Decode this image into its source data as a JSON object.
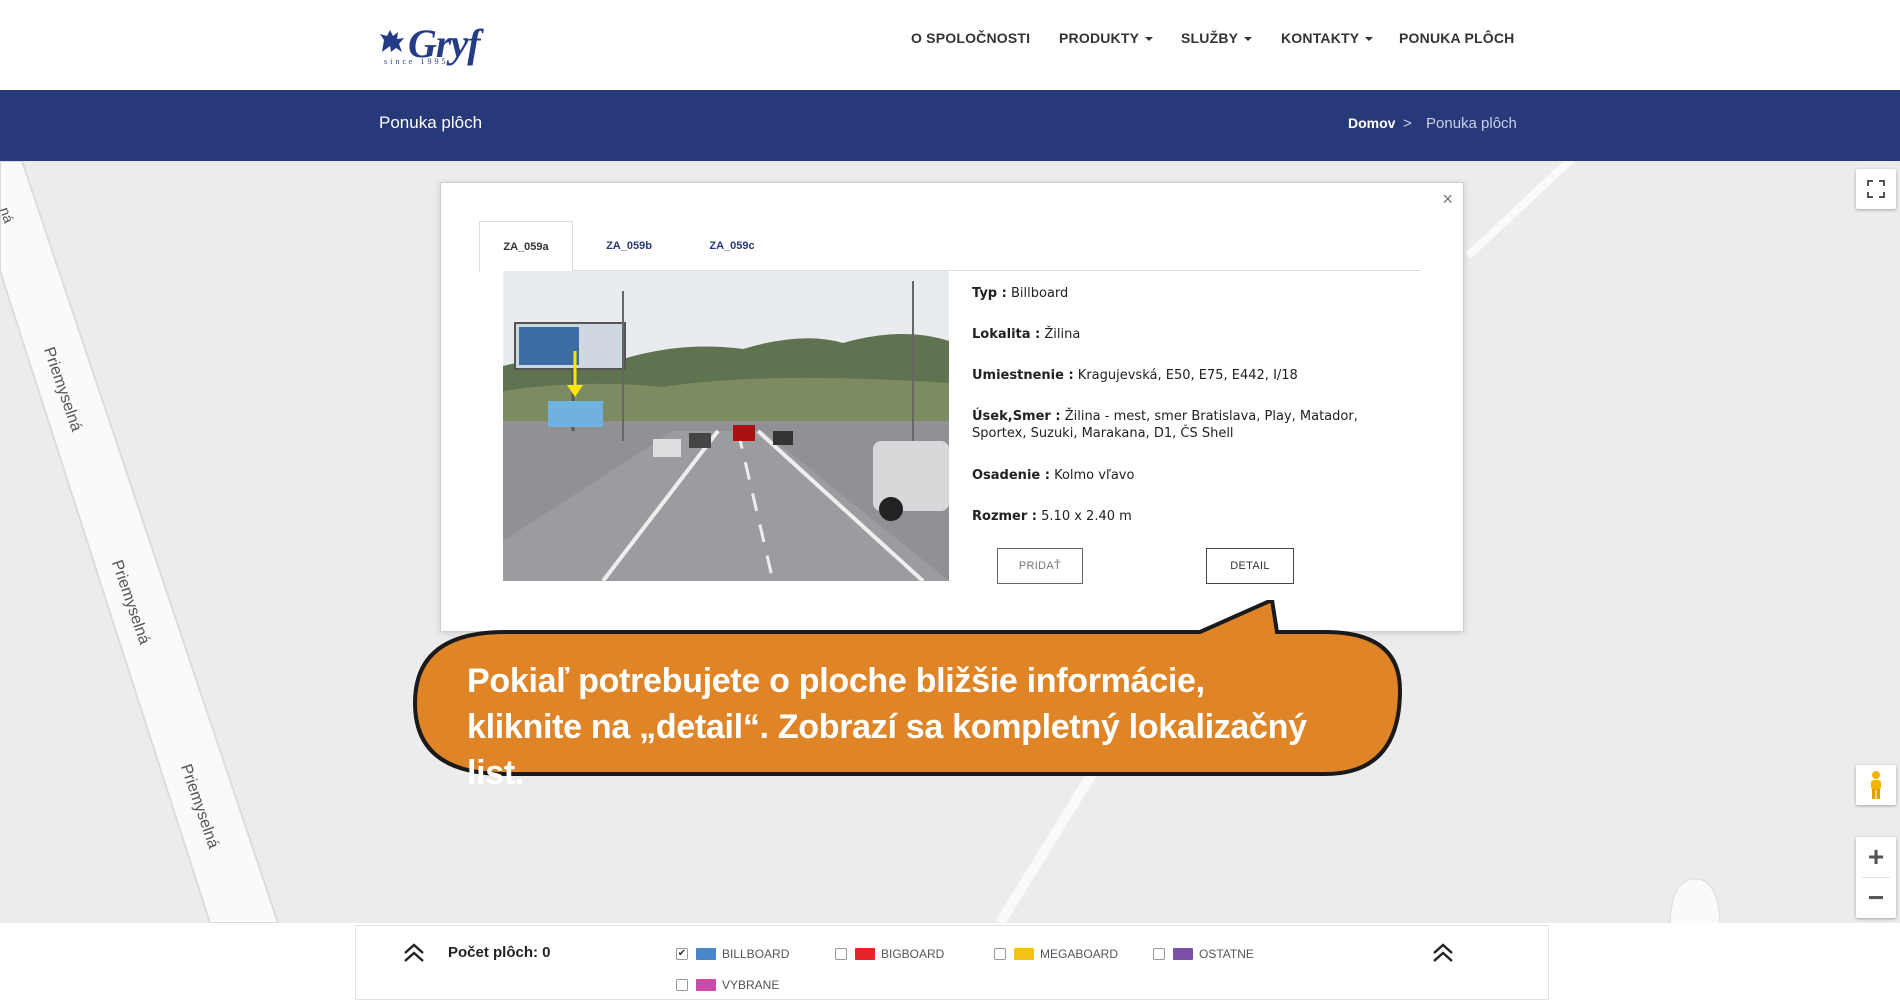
{
  "header": {
    "logo_text": "Gryf",
    "logo_since": "since 1995",
    "nav": [
      {
        "label": "O SPOLOČNOSTI",
        "has_dropdown": false
      },
      {
        "label": "PRODUKTY",
        "has_dropdown": true
      },
      {
        "label": "SLUŽBY",
        "has_dropdown": true
      },
      {
        "label": "KONTAKTY",
        "has_dropdown": true
      },
      {
        "label": "PONUKA PLÔCH",
        "has_dropdown": false
      }
    ]
  },
  "band": {
    "title": "Ponuka plôch",
    "breadcrumb": {
      "home": "Domov",
      "separator": ">",
      "current": "Ponuka plôch"
    }
  },
  "map": {
    "road_labels": [
      "Priemyselná",
      "Priemyselná",
      "Priemyselná"
    ],
    "edge_label": "ná",
    "controls": {
      "fullscreen": "⛶",
      "zoom_in": "+",
      "zoom_out": "−"
    }
  },
  "popup": {
    "close": "×",
    "tabs": [
      "ZA_059a",
      "ZA_059b",
      "ZA_059c"
    ],
    "active_tab": 0,
    "fields": [
      {
        "label": "Typ :",
        "value": "Billboard"
      },
      {
        "label": "Lokalita :",
        "value": "Žilina"
      },
      {
        "label": "Umiestnenie :",
        "value": "Kragujevská, E50, E75, E442, I/18"
      },
      {
        "label": "Úsek,Smer :",
        "value": "Žilina - mest, smer Bratislava, Play, Matador, Sportex, Suzuki, Marakana, D1, ČS Shell"
      },
      {
        "label": "Osadenie :",
        "value": "Kolmo vľavo"
      },
      {
        "label": "Rozmer :",
        "value": "5.10 x 2.40 m"
      }
    ],
    "buttons": {
      "add": "PRIDAŤ",
      "detail": "DETAIL"
    }
  },
  "callout": {
    "line1": "Pokiaľ potrebujete o ploche bližšie informácie,",
    "line2": "kliknite na „detail“. Zobrazí sa kompletný lokalizačný list.",
    "color": "#e08527"
  },
  "bottom_panel": {
    "count_label": "Počet plôch: 0",
    "legend": [
      {
        "label": "BILLBOARD",
        "color": "#4a86c8",
        "checked": true
      },
      {
        "label": "BIGBOARD",
        "color": "#e8242b",
        "checked": false
      },
      {
        "label": "MEGABOARD",
        "color": "#f4c215",
        "checked": false
      },
      {
        "label": "OSTATNE",
        "color": "#7b4fa6",
        "checked": false
      },
      {
        "label": "VYBRANE",
        "color": "#cc4aa8",
        "checked": false
      }
    ]
  }
}
